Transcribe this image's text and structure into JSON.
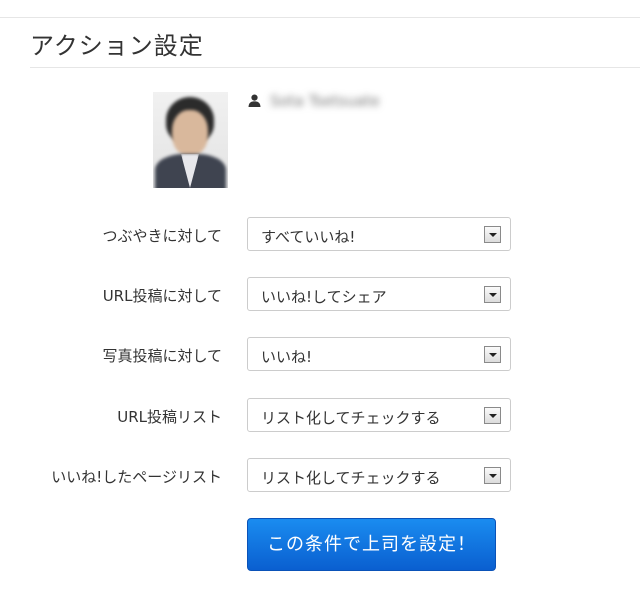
{
  "page": {
    "title": "アクション設定"
  },
  "profile": {
    "name": "Sota Tsetsuate",
    "avatar_icon": "person-photo",
    "user_icon": "user-icon"
  },
  "settings": [
    {
      "label": "つぶやきに対して",
      "value": "すべていいね!"
    },
    {
      "label": "URL投稿に対して",
      "value": "いいね!してシェア"
    },
    {
      "label": "写真投稿に対して",
      "value": "いいね!"
    },
    {
      "label": "URL投稿リスト",
      "value": "リスト化してチェックする"
    },
    {
      "label": "いいね!したページリスト",
      "value": "リスト化してチェックする"
    }
  ],
  "actions": {
    "submit_label": "この条件で上司を設定！"
  },
  "colors": {
    "button_top": "#1a8cf0",
    "button_bottom": "#0a5fd0",
    "divider": "#e6e6e6"
  }
}
